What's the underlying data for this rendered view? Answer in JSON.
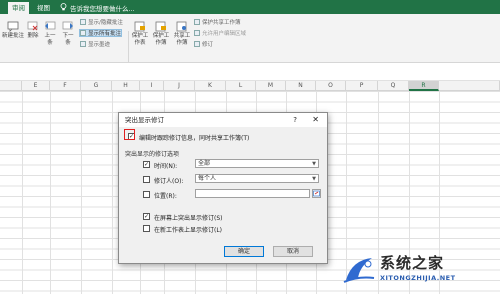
{
  "ribbon_tabs": [
    {
      "label": "审阅"
    },
    {
      "label": "视图"
    }
  ],
  "tell_me": "告诉我您想要做什么...",
  "ribbon": {
    "buttons": [
      {
        "label": "新建批注"
      },
      {
        "label": "删除"
      },
      {
        "label": "上一条"
      },
      {
        "label": "下一条"
      }
    ],
    "small": [
      {
        "label": "显示/隐藏批注"
      },
      {
        "label": "显示所有批注"
      },
      {
        "label": "显示墨迹"
      }
    ],
    "protect": [
      {
        "label": "保护工作表"
      },
      {
        "label": "保护工作簿"
      },
      {
        "label": "共享工作簿"
      }
    ],
    "protect_small": [
      {
        "label": "保护共享工作簿"
      },
      {
        "label": "允许用户编辑区域"
      },
      {
        "label": "修订"
      }
    ],
    "groups": [
      "批注",
      "更改"
    ]
  },
  "columns": [
    "E",
    "F",
    "G",
    "H",
    "I",
    "J",
    "K",
    "L",
    "M",
    "N",
    "O",
    "P",
    "Q",
    "R"
  ],
  "selected_column": "R",
  "dialog": {
    "title": "突出显示修订",
    "help": "?",
    "close": "✕",
    "track_label": "编辑时跟踪修订信息，同时共享工作簿(T)",
    "section": "突出显示的修订选项",
    "when_label": "时间(N):",
    "when_value": "全部",
    "who_label": "修订人(O):",
    "who_value": "每个人",
    "where_label": "位置(R):",
    "onscreen_label": "在屏幕上突出显示修订(S)",
    "newsheet_label": "在新工作表上显示修订(L)",
    "ok": "确定",
    "cancel": "取消"
  },
  "watermark": {
    "text": "系统之家",
    "url": "XITONGZHIJIA.NET"
  }
}
